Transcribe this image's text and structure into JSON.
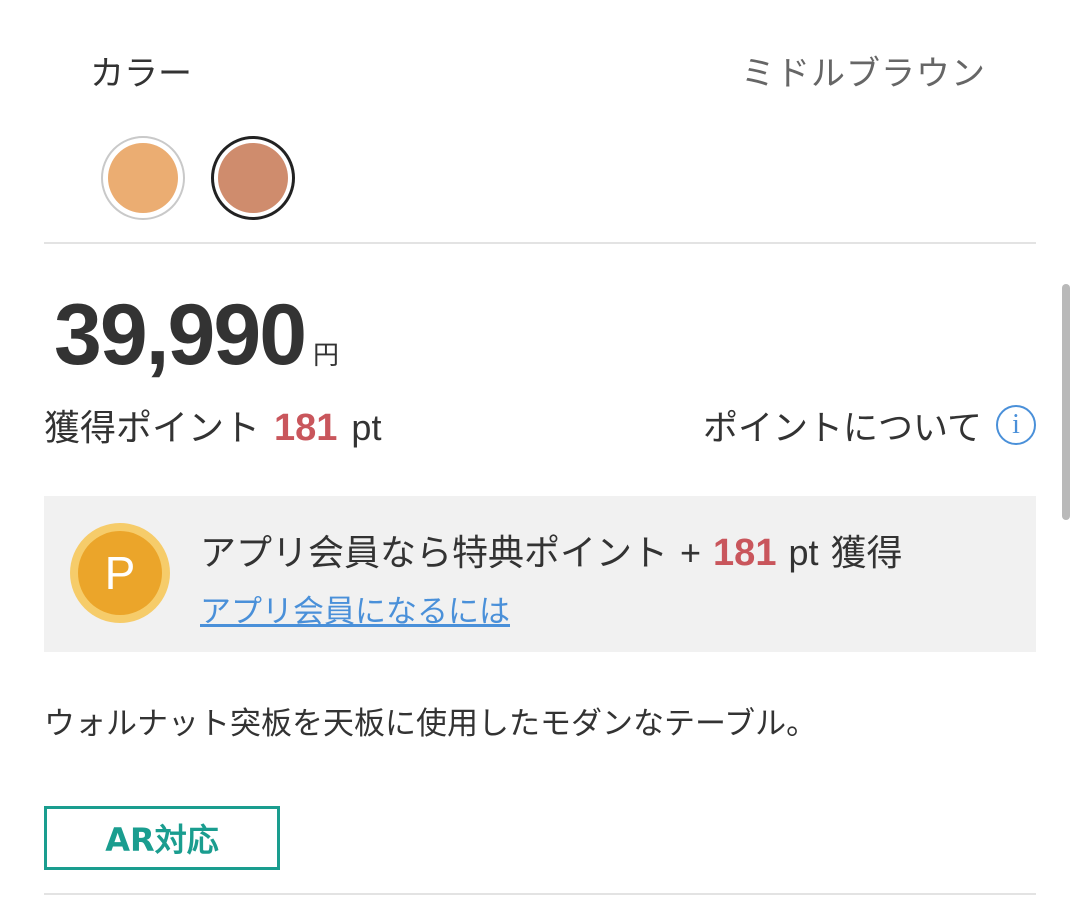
{
  "color_selector": {
    "label": "カラー",
    "selected_value": "ミドルブラウン",
    "swatches": [
      {
        "name": "light-brown",
        "color": "#ebad72",
        "selected": false
      },
      {
        "name": "middle-brown",
        "color": "#cf8c6d",
        "selected": true
      }
    ]
  },
  "price": {
    "amount": "39,990",
    "currency": "円"
  },
  "points": {
    "label": "獲得ポイント",
    "value": "181",
    "unit": "pt",
    "about_link": "ポイントについて",
    "info_icon": "info-circle-icon"
  },
  "app_member": {
    "icon_letter": "P",
    "text_prefix": "アプリ会員なら特典ポイント",
    "plus": "+",
    "points": "181",
    "unit": "pt",
    "suffix": "獲得",
    "link": "アプリ会員になるには"
  },
  "description": "ウォルナット突板を天板に使用したモダンなテーブル。",
  "badge": "AR対応",
  "colors": {
    "text": "#333333",
    "accent_red": "#c9565c",
    "link_blue": "#4a90d9",
    "ar_teal": "#1a9d8f",
    "coin_gold": "#eba52a"
  }
}
